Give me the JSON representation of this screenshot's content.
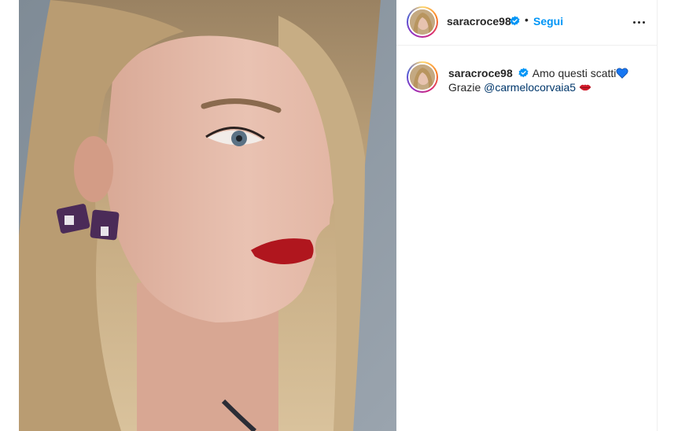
{
  "post": {
    "author": {
      "username": "saracroce98",
      "verified": true,
      "avatar": "profile-photo"
    },
    "header": {
      "separator": "•",
      "follow_label": "Segui",
      "more_icon": "more-horizontal-icon"
    },
    "caption": {
      "username": "saracroce98",
      "text_part1": "Amo questi scatti",
      "emoji1": "blue-heart-emoji",
      "text_part2": "Grazie",
      "mention": "@carmelocorvaia5",
      "emoji2": "red-lips-emoji"
    },
    "media": {
      "type": "photo",
      "subject": "portrait"
    }
  },
  "colors": {
    "follow_blue": "#0095f6",
    "mention_blue": "#00376b",
    "verified_blue": "#0095f6",
    "text": "#262626",
    "divider": "#efefef"
  }
}
